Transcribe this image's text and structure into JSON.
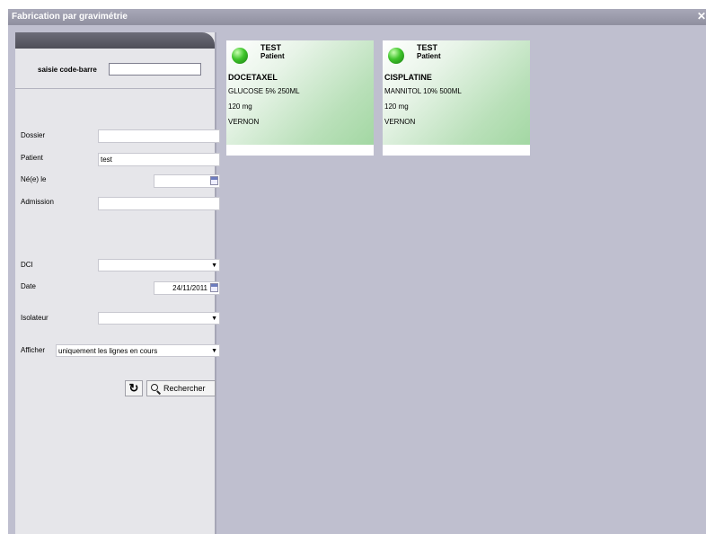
{
  "window": {
    "title": "Fabrication par gravimétrie",
    "close_icon": "close-icon"
  },
  "search_panel": {
    "barcode_label": "saisie code-barre",
    "barcode_value": "",
    "fields": {
      "dossier": {
        "label": "Dossier",
        "value": ""
      },
      "patient": {
        "label": "Patient",
        "value": "test"
      },
      "birthdate": {
        "label": "Né(e) le",
        "value": ""
      },
      "admission": {
        "label": "Admission",
        "value": ""
      },
      "dci": {
        "label": "DCI",
        "value": ""
      },
      "date": {
        "label": "Date",
        "value": "24/11/2011"
      },
      "isolateur": {
        "label": "Isolateur",
        "value": ""
      },
      "afficher": {
        "label": "Afficher",
        "value": "uniquement les lignes en cours"
      }
    },
    "search_button": "Rechercher"
  },
  "cards": [
    {
      "name": "TEST",
      "role": "Patient",
      "drug": "DOCETAXEL",
      "solution": "GLUCOSE 5% 250ML",
      "dose": "120 mg",
      "site": "VERNON",
      "status_color": "#3ec42a"
    },
    {
      "name": "TEST",
      "role": "Patient",
      "drug": "CISPLATINE",
      "solution": "MANNITOL 10% 500ML",
      "dose": "120 mg",
      "site": "VERNON",
      "status_color": "#3ec42a"
    }
  ]
}
